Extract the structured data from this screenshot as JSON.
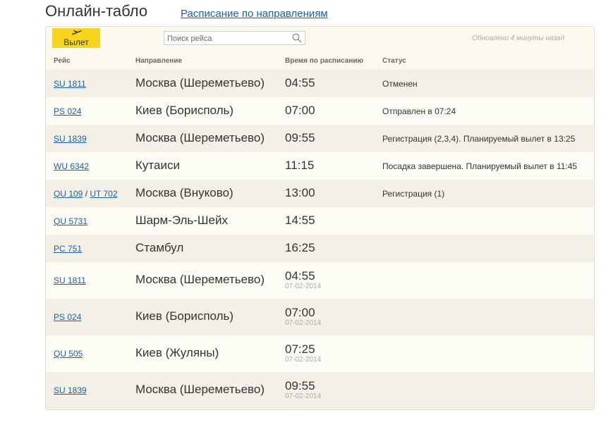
{
  "header": {
    "title": "Онлайн-табло",
    "link": "Расписание по направлениям"
  },
  "toolbar": {
    "depart_label": "Вылет",
    "search_placeholder": "Поиск рейса",
    "updated": "Обновлено 4 минуты назад"
  },
  "columns": {
    "flight": "Рейс",
    "direction": "Направление",
    "time": "Время по расписанию",
    "status": "Статус"
  },
  "colors": {
    "accent": "#f7d51d",
    "link": "#1a5ea8"
  },
  "rows": [
    {
      "flights": [
        "SU 1811"
      ],
      "direction": "Москва (Шереметьево)",
      "time": "04:55",
      "date": "",
      "status": "Отменен"
    },
    {
      "flights": [
        "PS 024"
      ],
      "direction": "Киев (Борисполь)",
      "time": "07:00",
      "date": "",
      "status": "Отправлен в 07:24"
    },
    {
      "flights": [
        "SU 1839"
      ],
      "direction": "Москва (Шереметьево)",
      "time": "09:55",
      "date": "",
      "status": "Регистрация (2,3,4). Планируемый вылет в 13:25"
    },
    {
      "flights": [
        "WU 6342"
      ],
      "direction": "Кутаиси",
      "time": "11:15",
      "date": "",
      "status": "Посадка завершена. Планируемый вылет в 11:45"
    },
    {
      "flights": [
        "QU 109",
        "UT 702"
      ],
      "direction": "Москва (Внуково)",
      "time": "13:00",
      "date": "",
      "status": "Регистрация (1)"
    },
    {
      "flights": [
        "QU 5731"
      ],
      "direction": "Шарм-Эль-Шейх",
      "time": "14:55",
      "date": "",
      "status": ""
    },
    {
      "flights": [
        "PC 751"
      ],
      "direction": "Стамбул",
      "time": "16:25",
      "date": "",
      "status": ""
    },
    {
      "flights": [
        "SU 1811"
      ],
      "direction": "Москва (Шереметьево)",
      "time": "04:55",
      "date": "07-02-2014",
      "status": ""
    },
    {
      "flights": [
        "PS 024"
      ],
      "direction": "Киев (Борисполь)",
      "time": "07:00",
      "date": "07-02-2014",
      "status": ""
    },
    {
      "flights": [
        "QU 505"
      ],
      "direction": "Киев (Жуляны)",
      "time": "07:25",
      "date": "07-02-2014",
      "status": ""
    },
    {
      "flights": [
        "SU 1839"
      ],
      "direction": "Москва (Шереметьево)",
      "time": "09:55",
      "date": "07-02-2014",
      "status": ""
    }
  ]
}
